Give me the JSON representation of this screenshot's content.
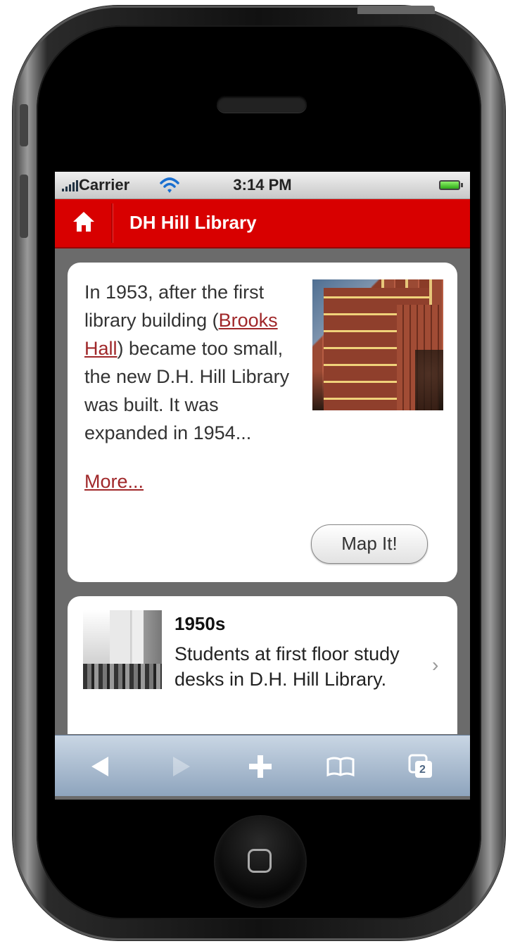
{
  "status_bar": {
    "carrier": "Carrier",
    "time": "3:14 PM"
  },
  "nav_bar": {
    "title": "DH Hill Library"
  },
  "intro_card": {
    "text_before_link": "In 1953, after the first library building (",
    "link_text": "Brooks Hall",
    "text_after_link": ") became too small, the new D.H. Hill Library was built. It was expanded in 1954...",
    "more_link": "More...",
    "map_button": "Map It!"
  },
  "timeline_item": {
    "title": "1950s",
    "description": "Students at first floor study desks in D.H. Hill Library."
  },
  "browser_toolbar": {
    "tab_count": "2"
  },
  "colors": {
    "nav_bar": "#d80000",
    "link": "#a0282a",
    "toolbar": "#8ea4bd"
  }
}
